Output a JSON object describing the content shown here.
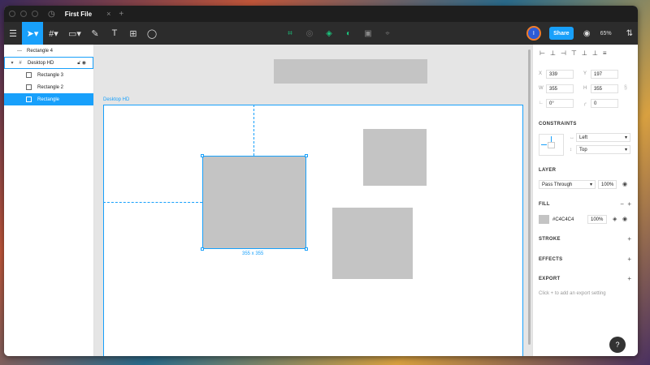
{
  "titlebar": {
    "file_title": "First File",
    "plus": "+",
    "close": "×"
  },
  "toolbar": {
    "zoom": "65%",
    "share_label": "Share",
    "avatar_initial": "I"
  },
  "layers": {
    "rect4": "Rectangle 4",
    "frame": "Desktop HD",
    "children": [
      "Rectangle 3",
      "Rectangle 2"
    ],
    "selected": "Rectangle"
  },
  "canvas": {
    "frame_label": "Desktop HD",
    "dimensions": "355 x 355"
  },
  "props": {
    "x_label": "X",
    "x": "339",
    "y_label": "Y",
    "y": "197",
    "w_label": "W",
    "w": "355",
    "h_label": "H",
    "h": "355",
    "rotation": "0°",
    "radius": "0",
    "constraints_title": "CONSTRAINTS",
    "constraint_h": "Left",
    "constraint_v": "Top",
    "layer_title": "LAYER",
    "blend": "Pass Through",
    "layer_opacity": "100%",
    "fill_title": "FILL",
    "fill_hex": "#C4C4C4",
    "fill_opacity": "100%",
    "stroke_title": "STROKE",
    "effects_title": "EFFECTS",
    "export_title": "EXPORT",
    "export_hint": "Click + to add an export setting"
  },
  "help": "?",
  "colors": {
    "accent": "#18a0fb",
    "fill": "#c4c4c4",
    "dark": "#2c2c2c"
  }
}
